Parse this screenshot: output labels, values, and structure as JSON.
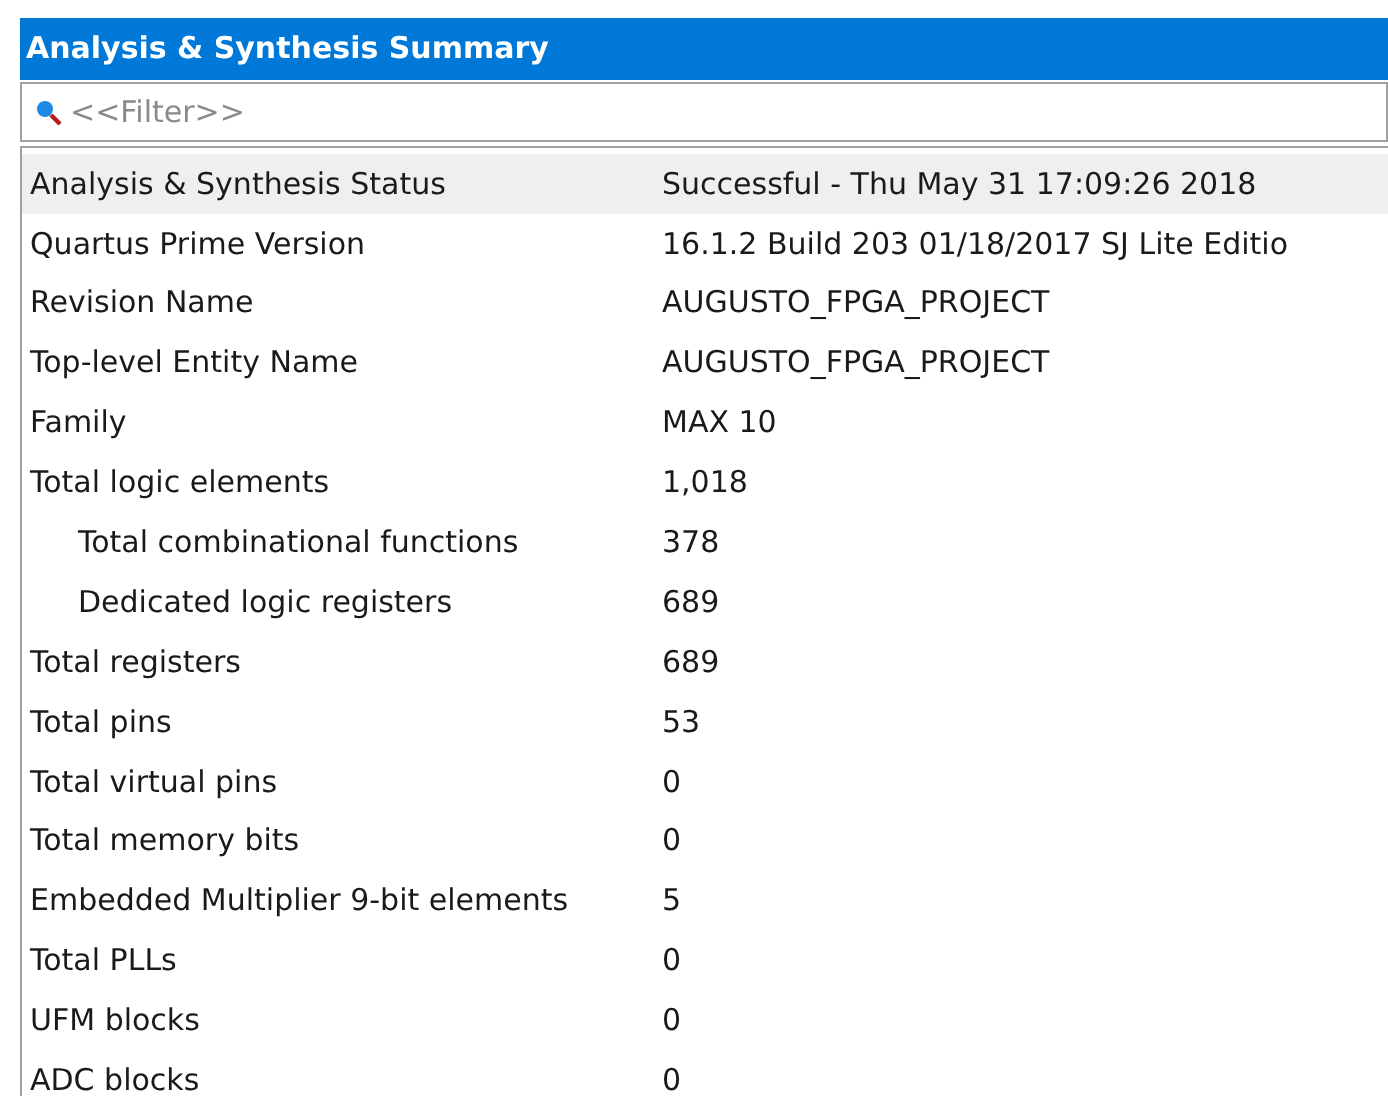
{
  "panel": {
    "title": "Analysis & Synthesis Summary"
  },
  "filter": {
    "placeholder": "<<Filter>>"
  },
  "rows": [
    {
      "label": "Analysis & Synthesis Status",
      "value": "Successful - Thu May 31 17:09:26 2018",
      "selected": true
    },
    {
      "label": "Quartus Prime Version",
      "value": "16.1.2 Build 203 01/18/2017 SJ Lite Editio",
      "selected": false
    },
    {
      "label": "Revision Name",
      "value": "AUGUSTO_FPGA_PROJECT",
      "selected": false
    },
    {
      "label": "Top-level Entity Name",
      "value": "AUGUSTO_FPGA_PROJECT",
      "selected": false
    },
    {
      "label": "Family",
      "value": "MAX 10",
      "selected": false
    },
    {
      "label": "Total logic elements",
      "value": "1,018",
      "selected": false,
      "children": [
        {
          "label": "Total combinational functions",
          "value": "378",
          "selected": false
        },
        {
          "label": "Dedicated logic registers",
          "value": "689",
          "selected": false
        }
      ]
    },
    {
      "label": "Total registers",
      "value": "689",
      "selected": false
    },
    {
      "label": "Total pins",
      "value": "53",
      "selected": false
    },
    {
      "label": "Total virtual pins",
      "value": "0",
      "selected": false
    },
    {
      "label": "Total memory bits",
      "value": "0",
      "selected": false
    },
    {
      "label": "Embedded Multiplier 9-bit elements",
      "value": "5",
      "selected": false
    },
    {
      "label": "Total PLLs",
      "value": "0",
      "selected": false
    },
    {
      "label": "UFM blocks",
      "value": "0",
      "selected": false
    },
    {
      "label": "ADC blocks",
      "value": "0",
      "selected": false
    }
  ]
}
